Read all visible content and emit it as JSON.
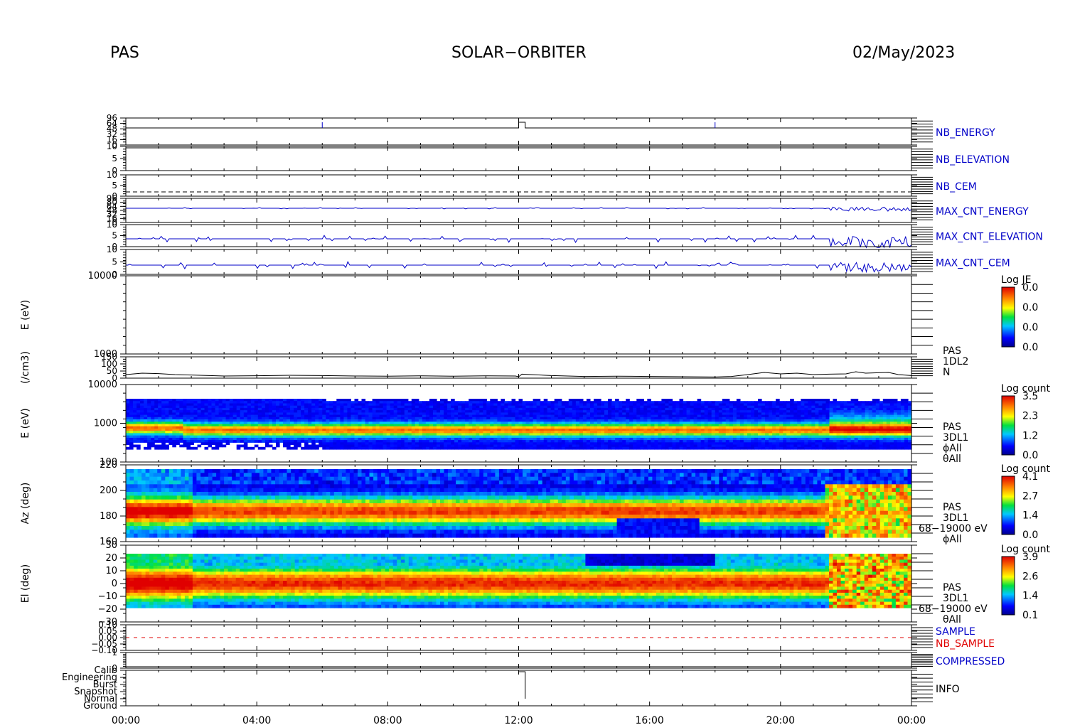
{
  "header": {
    "left": "PAS",
    "center": "SOLAR−ORBITER",
    "right": "02/May/2023"
  },
  "colors": {
    "blue": "#0000c8",
    "red": "#e00000",
    "black": "#000000"
  },
  "chart_data": {
    "type": "heatmap",
    "x_axis": {
      "ticks": [
        "00:00",
        "04:00",
        "08:00",
        "12:00",
        "16:00",
        "20:00",
        "00:00"
      ],
      "range_hours": [
        0,
        24
      ]
    },
    "panels": [
      {
        "key": "nb_energy",
        "label": "NB_ENERGY",
        "label_color": "blue",
        "tick_labels": [
          "96",
          "64",
          "48",
          "32",
          "16",
          "0"
        ],
        "type": "line",
        "series": [
          {
            "x": [
              0,
              5.9,
              6.0,
              11.9,
              12.0,
              12.2,
              17.9,
              18.0,
              24
            ],
            "y": [
              0,
              0,
              1,
              1,
              1,
              0,
              0,
              1,
              0
            ]
          }
        ]
      },
      {
        "key": "nb_elevation",
        "label": "NB_ELEVATION",
        "label_color": "blue",
        "tick_labels": [
          "10",
          "5",
          "0"
        ],
        "type": "line",
        "series": [
          {
            "x": [
              0,
              24
            ],
            "y": [
              0,
              0
            ]
          }
        ]
      },
      {
        "key": "nb_cem",
        "label": "NB_CEM",
        "label_color": "blue",
        "tick_labels": [
          "10",
          "5",
          "0"
        ],
        "type": "dashed-line"
      },
      {
        "key": "max_cnt_energy",
        "label": "MAX_CNT_ENERGY",
        "label_color": "blue",
        "tick_labels": [
          "96",
          "80",
          "64",
          "48",
          "32",
          "16",
          "0"
        ],
        "type": "line"
      },
      {
        "key": "max_cnt_elevation",
        "label": "MAX_CNT_ELEVATION",
        "label_color": "blue",
        "tick_labels": [
          "10",
          "5",
          "0"
        ],
        "type": "line"
      },
      {
        "key": "max_cnt_cem",
        "label": "MAX_CNT_CEM",
        "label_color": "blue",
        "tick_labels": [
          "10",
          "5",
          "0"
        ],
        "type": "line"
      },
      {
        "key": "pas_1dl2_e",
        "ylabel": "E (eV)",
        "tick_labels": [
          "10000",
          "1000"
        ],
        "type": "heatmap-empty",
        "colorbar": {
          "title": "Log JE",
          "ticks": [
            "0.0",
            "0.0",
            "0.0",
            "0.0"
          ]
        }
      },
      {
        "key": "pas_1dl2_n",
        "ylabel": "(/cm3)",
        "tick_labels": [
          "150",
          "100",
          "50",
          "0"
        ],
        "right_labels": [
          "PAS",
          "1DL2",
          "N"
        ],
        "type": "line",
        "x": [
          0,
          0.5,
          1,
          1.5,
          2,
          3,
          4,
          5,
          6,
          7,
          8,
          9,
          10,
          11,
          11.9,
          12,
          12.1,
          13,
          14,
          15,
          16,
          17,
          18,
          18.5,
          19,
          19.5,
          20,
          20.5,
          21,
          21.5,
          22,
          22.3,
          22.6,
          23,
          23.3,
          23.6,
          24
        ],
        "y": [
          25,
          35,
          32,
          25,
          22,
          15,
          17,
          20,
          18,
          15,
          14,
          16,
          14,
          16,
          15,
          10,
          28,
          18,
          12,
          14,
          12,
          10,
          8,
          12,
          25,
          40,
          30,
          35,
          25,
          28,
          30,
          45,
          35,
          38,
          40,
          25,
          18
        ]
      },
      {
        "key": "pas_3dl1_e",
        "ylabel": "E (eV)",
        "tick_labels": [
          "10000",
          "1000",
          "100"
        ],
        "right_labels": [
          "PAS",
          "3DL1",
          "ϕAll",
          "θAll"
        ],
        "type": "heatmap",
        "colorbar": {
          "title": "Log count",
          "ticks": [
            "3.5",
            "2.3",
            "1.2",
            "0.0"
          ]
        }
      },
      {
        "key": "pas_3dl1_az",
        "ylabel": "Az (deg)",
        "tick_labels": [
          "220",
          "200",
          "180",
          "160"
        ],
        "right_labels": [
          "PAS",
          "3DL1",
          "68−19000 eV",
          "ϕAll"
        ],
        "type": "heatmap",
        "colorbar": {
          "title": "Log count",
          "ticks": [
            "4.1",
            "2.7",
            "1.4",
            "0.0"
          ]
        }
      },
      {
        "key": "pas_3dl1_el",
        "ylabel": "El (deg)",
        "tick_labels": [
          "30",
          "20",
          "10",
          "0",
          "−10",
          "−20",
          "−30"
        ],
        "right_labels": [
          "PAS",
          "3DL1",
          "68−19000 eV",
          "θAll"
        ],
        "type": "heatmap",
        "colorbar": {
          "title": "Log count",
          "ticks": [
            "3.9",
            "2.6",
            "1.4",
            "0.1"
          ]
        }
      },
      {
        "key": "sample",
        "label": "SAMPLE",
        "label_color": "blue",
        "label2": "NB_SAMPLE",
        "label2_color": "red",
        "tick_labels": [
          "0.10",
          "0.05",
          "0.00",
          "−0.05",
          "−0.10"
        ],
        "type": "dashed-line"
      },
      {
        "key": "compressed",
        "label": "COMPRESSED",
        "label_color": "blue",
        "tick_labels": [
          "1",
          "0"
        ],
        "type": "line"
      },
      {
        "key": "info",
        "label": "INFO",
        "label_color": "black",
        "tick_labels": [
          "Calib",
          "Engineering",
          "Burst",
          "Snapshot",
          "Normal",
          "Ground"
        ],
        "type": "step"
      }
    ]
  }
}
